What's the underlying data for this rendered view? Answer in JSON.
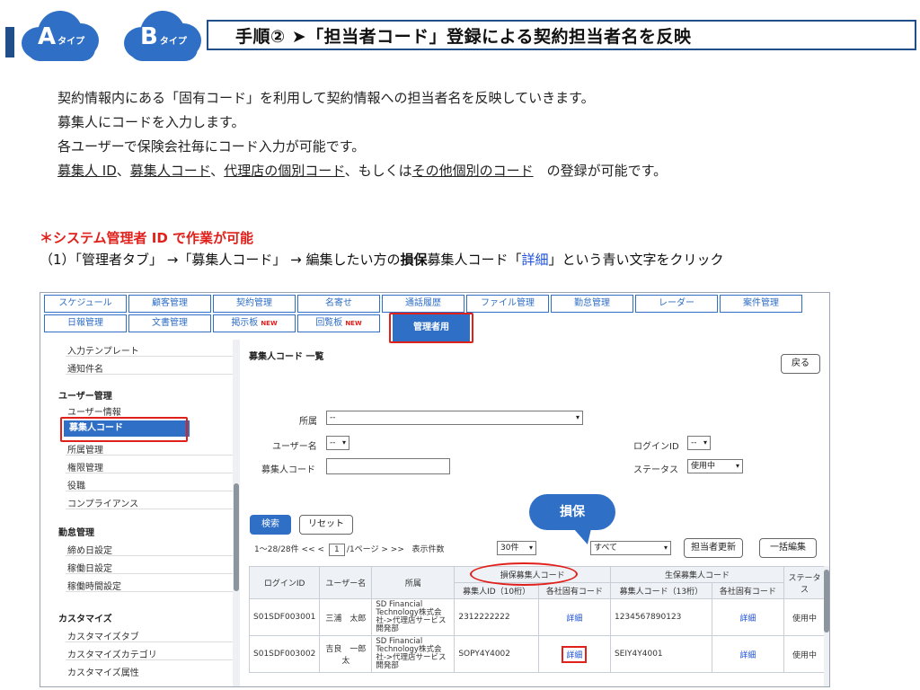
{
  "header": {
    "badge_a_letter": "A",
    "badge_a_sub": "タイプ",
    "badge_b_letter": "B",
    "badge_b_sub": "タイプ",
    "title": "手順② ➤「担当者コード」登録による契約担当者名を反映",
    "accent_color": "#2f6fc5"
  },
  "intro": {
    "line1": "契約情報内にある「固有コード」を利用して契約情報への担当者名を反映していきます。",
    "line2": "募集人にコードを入力します。",
    "line3": "各ユーザーで保険会社毎にコード入力が可能です。",
    "line4_parts": [
      "募集人 ID",
      "、",
      "募集人コード",
      "、",
      "代理店の個別コード",
      "、もしくは",
      "その他個別のコード",
      "　の登録が可能です。"
    ]
  },
  "notice": "＊システム管理者 ID で作業が可能",
  "step": {
    "part1": "（1）「管理者タブ」 →「募集人コード」 → 編集したい方の",
    "bold": "損保",
    "part2": "募集人コード「",
    "blue": "詳細",
    "part3": "」という青い文字をクリック"
  },
  "app": {
    "tabs_row1": [
      "スケジュール",
      "顧客管理",
      "契約管理",
      "名寄せ",
      "通話履歴",
      "ファイル管理",
      "勤怠管理",
      "レーダー",
      "案件管理"
    ],
    "tabs_row2": [
      "日報管理",
      "文書管理",
      "掲示板",
      "回覧板",
      "管理者用"
    ],
    "new_badge": "NEW",
    "sidebar": {
      "top_items": [
        "入力テンプレート",
        "通知件名"
      ],
      "user_head": "ユーザー管理",
      "user_items": [
        "ユーザー情報",
        "募集人コード",
        "所属管理",
        "権限管理",
        "役職",
        "コンプライアンス"
      ],
      "attend_head": "勤怠管理",
      "attend_items": [
        "締め日設定",
        "稼働日設定",
        "稼働時間設定"
      ],
      "custom_head": "カスタマイズ",
      "custom_items": [
        "カスタマイズタブ",
        "カスタマイズカテゴリ",
        "カスタマイズ属性"
      ]
    },
    "main": {
      "title": "募集人コード 一覧",
      "back": "戻る",
      "label_affil": "所属",
      "affil_value": "--",
      "label_user": "ユーザー名",
      "user_value": "--",
      "label_code": "募集人コード",
      "label_login": "ログインID",
      "login_value": "--",
      "label_status": "ステータス",
      "status_value": "使用中",
      "search": "検索",
      "reset": "リセット",
      "pager_range": "1～28/28件",
      "pager_prev": "<< <",
      "pager_page": "1",
      "pager_total": "/1ページ",
      "pager_next": "> >>",
      "per_page_label": "表示件数",
      "per_page_value": "30件",
      "filter_value": "すべて",
      "update_btn": "担当者更新",
      "bulk_btn": "一括編集",
      "callout": "損保"
    },
    "table": {
      "h_login": "ログインID",
      "h_user": "ユーザー名",
      "h_affil": "所属",
      "h_sonpo": "損保募集人コード",
      "h_seiho": "生保募集人コード",
      "h_status": "ステータス",
      "h_sonpo_id": "募集人ID（10桁）",
      "h_sonpo_own": "各社固有コード",
      "h_seiho_code": "募集人コード（13桁）",
      "h_seiho_own": "各社固有コード",
      "rows": [
        {
          "login": "S01SDF003001",
          "user": "三浦　太郎",
          "affil": "SD Financial Technology株式会社->代理店サービス開発部",
          "sonpo_id": "2312222222",
          "sonpo_own": "詳細",
          "seiho_code": "1234567890123",
          "seiho_own": "詳細",
          "status": "使用中"
        },
        {
          "login": "S01SDF003002",
          "user": "吉良　一郎太",
          "affil": "SD Financial Technology株式会社->代理店サービス開発部",
          "sonpo_id": "SOPY4Y4002",
          "sonpo_own": "詳細",
          "seiho_code": "SEIY4Y4001",
          "seiho_own": "詳細",
          "status": "使用中"
        }
      ]
    }
  }
}
